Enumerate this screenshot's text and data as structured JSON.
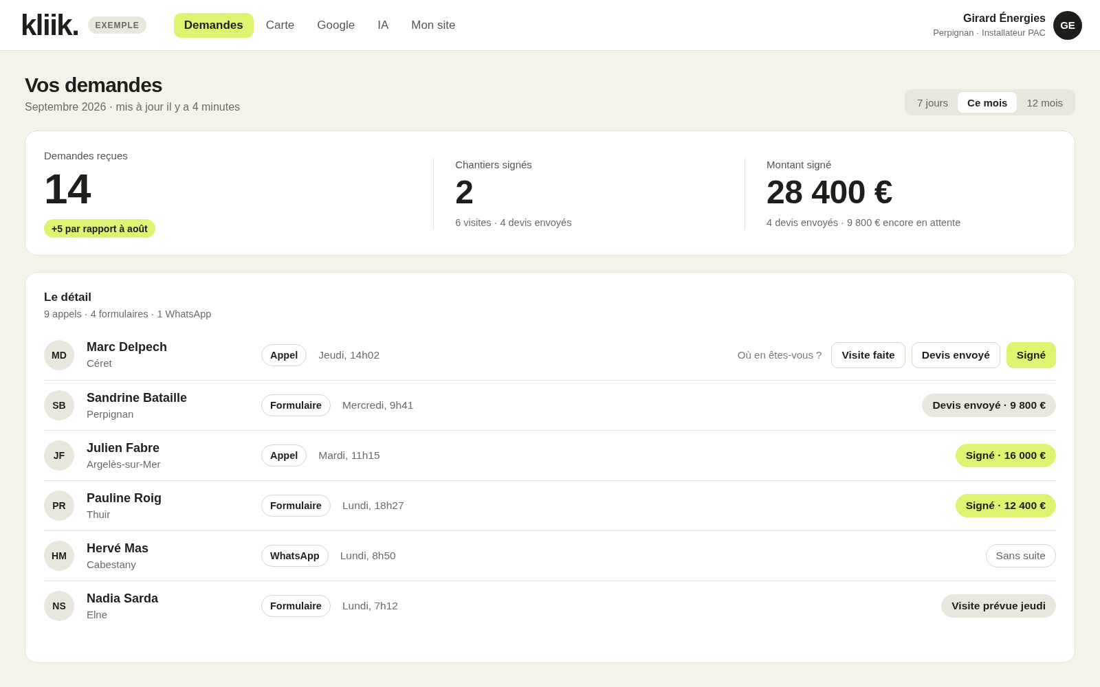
{
  "header": {
    "logo": "kliik.",
    "badge": "EXEMPLE",
    "nav": [
      {
        "label": "Demandes",
        "selected": true
      },
      {
        "label": "Carte",
        "selected": false
      },
      {
        "label": "Google",
        "selected": false
      },
      {
        "label": "IA",
        "selected": false
      },
      {
        "label": "Mon site",
        "selected": false
      }
    ],
    "account": {
      "name": "Girard Énergies",
      "subtitle": "Perpignan · Installateur PAC",
      "initials": "GE"
    }
  },
  "page": {
    "title": "Vos demandes",
    "subtitle": "Septembre 2026 · mis à jour il y a 4 minutes",
    "periods": [
      {
        "label": "7 jours",
        "selected": false
      },
      {
        "label": "Ce mois",
        "selected": true
      },
      {
        "label": "12 mois",
        "selected": false
      }
    ]
  },
  "stats": [
    {
      "kind": "primary",
      "label": "Demandes reçues",
      "value": "14",
      "trend": "+5 par rapport à août"
    },
    {
      "kind": "secondary",
      "label": "Chantiers signés",
      "value": "2",
      "note": "6 visites · 4 devis envoyés"
    },
    {
      "kind": "secondary",
      "label": "Montant signé",
      "value": "28 400 €",
      "note": "4 devis envoyés · 9 800 € encore en attente"
    }
  ],
  "detail": {
    "title": "Le détail",
    "subtitle": "9 appels · 4 formulaires · 1 WhatsApp",
    "rows": [
      {
        "initials": "MD",
        "name": "Marc Delpech",
        "city": "Céret",
        "channel": "Appel",
        "time": "Jeudi, 14h02",
        "status": {
          "kind": "question",
          "prompt": "Où en êtes-vous ?",
          "options": [
            {
              "label": "Visite faite",
              "selected": false
            },
            {
              "label": "Devis envoyé",
              "selected": false
            },
            {
              "label": "Signé",
              "selected": true
            }
          ]
        }
      },
      {
        "initials": "SB",
        "name": "Sandrine Bataille",
        "city": "Perpignan",
        "channel": "Formulaire",
        "time": "Mercredi, 9h41",
        "status": {
          "kind": "quote",
          "label": "Devis envoyé · 9 800 €"
        }
      },
      {
        "initials": "JF",
        "name": "Julien Fabre",
        "city": "Argelès-sur-Mer",
        "channel": "Appel",
        "time": "Mardi, 11h15",
        "status": {
          "kind": "signed",
          "label": "Signé · 16 000 €"
        }
      },
      {
        "initials": "PR",
        "name": "Pauline Roig",
        "city": "Thuir",
        "channel": "Formulaire",
        "time": "Lundi, 18h27",
        "status": {
          "kind": "signed",
          "label": "Signé · 12 400 €"
        }
      },
      {
        "initials": "HM",
        "name": "Hervé Mas",
        "city": "Cabestany",
        "channel": "WhatsApp",
        "time": "Lundi, 8h50",
        "status": {
          "kind": "dropped",
          "label": "Sans suite"
        }
      },
      {
        "initials": "NS",
        "name": "Nadia Sarda",
        "city": "Elne",
        "channel": "Formulaire",
        "time": "Lundi, 7h12",
        "status": {
          "kind": "planned",
          "label": "Visite prévue jeudi"
        }
      }
    ]
  }
}
